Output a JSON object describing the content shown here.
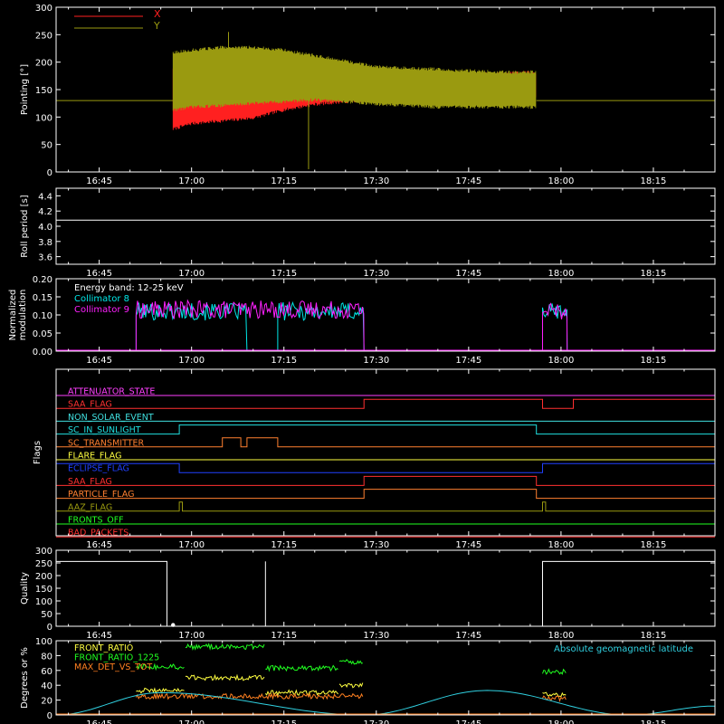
{
  "colors": {
    "background": "#000000",
    "frame": "#ffffff",
    "x_series": "#ff2020",
    "y_series": "#9a9a10",
    "collimator8": "#00e8e8",
    "collimator9": "#ff20ff",
    "front_ratio": "#ffff40",
    "front_ratio_1225": "#20ff20",
    "max_det": "#ff8020",
    "geomag": "#30d0e0"
  },
  "chart_data": [
    {
      "id": "pointing",
      "type": "line",
      "xlabel": "",
      "ylabel": "Pointing [°]",
      "x_ticks": [
        "16:45",
        "17:00",
        "17:15",
        "17:30",
        "17:45",
        "18:00",
        "18:15"
      ],
      "x_range": [
        "16:38",
        "18:25"
      ],
      "ylim": [
        0,
        300
      ],
      "y_ticks": [
        "0",
        "50",
        "100",
        "150",
        "200",
        "250",
        "300"
      ],
      "baseline": 130,
      "active_window": [
        "16:57",
        "17:56"
      ],
      "series": [
        {
          "name": "X",
          "color_key": "x_series",
          "x": [
            "16:57",
            "17:00",
            "17:05",
            "17:10",
            "17:15",
            "17:20",
            "17:25",
            "17:30",
            "17:40",
            "17:50",
            "17:56"
          ],
          "max": [
            190,
            185,
            185,
            185,
            185,
            183,
            182,
            180,
            180,
            182,
            185
          ],
          "min": [
            75,
            85,
            90,
            95,
            110,
            120,
            125,
            130,
            130,
            130,
            130
          ]
        },
        {
          "name": "Y",
          "color_key": "y_series",
          "x": [
            "16:57",
            "17:00",
            "17:05",
            "17:10",
            "17:15",
            "17:20",
            "17:25",
            "17:30",
            "17:40",
            "17:50",
            "17:56"
          ],
          "max": [
            220,
            225,
            230,
            230,
            225,
            215,
            205,
            195,
            190,
            185,
            185
          ],
          "min": [
            110,
            115,
            118,
            122,
            125,
            128,
            125,
            120,
            115,
            115,
            115
          ]
        }
      ],
      "spikes": [
        {
          "x": "17:06",
          "y": 255
        },
        {
          "x": "17:19",
          "y": 5
        }
      ]
    },
    {
      "id": "roll",
      "type": "line",
      "xlabel": "",
      "ylabel": "Roll period [s]",
      "x_ticks": [
        "16:45",
        "17:00",
        "17:15",
        "17:30",
        "17:45",
        "18:00",
        "18:15"
      ],
      "x_range": [
        "16:38",
        "18:25"
      ],
      "ylim": [
        3.5,
        4.5
      ],
      "y_ticks": [
        "3.6",
        "3.8",
        "4.0",
        "4.2",
        "4.4"
      ],
      "value": 4.08
    },
    {
      "id": "modulation",
      "type": "line",
      "xlabel": "",
      "ylabel": "Normalized modulation",
      "x_ticks": [
        "16:45",
        "17:00",
        "17:15",
        "17:30",
        "17:45",
        "18:00",
        "18:15"
      ],
      "x_range": [
        "16:38",
        "18:25"
      ],
      "ylim": [
        0,
        0.2
      ],
      "y_ticks": [
        "0.00",
        "0.05",
        "0.10",
        "0.15",
        "0.20"
      ],
      "annotation": "Energy band: 12-25 keV",
      "series": [
        {
          "name": "Collimator 8",
          "color_key": "collimator8",
          "segments": [
            {
              "x": [
                "16:51",
                "17:09"
              ],
              "mean": 0.11
            },
            {
              "x": [
                "17:14",
                "17:28"
              ],
              "mean": 0.11
            },
            {
              "x": [
                "17:57",
                "18:01"
              ],
              "mean": 0.11
            }
          ]
        },
        {
          "name": "Collimator 9",
          "color_key": "collimator9",
          "segments": [
            {
              "x": [
                "16:51",
                "17:28"
              ],
              "mean": 0.115
            },
            {
              "x": [
                "17:57",
                "18:01"
              ],
              "mean": 0.112
            }
          ]
        }
      ]
    },
    {
      "id": "flags",
      "type": "line",
      "xlabel": "",
      "ylabel": "Flags",
      "x_ticks": [
        "16:45",
        "17:00",
        "17:15",
        "17:30",
        "17:45",
        "18:00",
        "18:15"
      ],
      "x_range": [
        "16:38",
        "18:25"
      ],
      "series": [
        {
          "name": "ATTENUATOR_STATE",
          "color": "#ff40ff",
          "high_intervals": []
        },
        {
          "name": "SAA_FLAG",
          "color": "#ff3030",
          "high_intervals": [
            [
              "17:28",
              "17:57"
            ],
            [
              "18:02",
              "18:25"
            ]
          ]
        },
        {
          "name": "NON_SOLAR_EVENT",
          "color": "#40e0e0",
          "high_intervals": []
        },
        {
          "name": "SC_IN_SUNLIGHT",
          "color": "#20e0e0",
          "high_intervals": [
            [
              "16:58",
              "17:56"
            ]
          ]
        },
        {
          "name": "SC_TRANSMITTER",
          "color": "#ff8030",
          "high_intervals": [
            [
              "17:05",
              "17:08"
            ],
            [
              "17:09",
              "17:14"
            ]
          ]
        },
        {
          "name": "FLARE_FLAG",
          "color": "#ffff40",
          "high_intervals": []
        },
        {
          "name": "ECLIPSE_FLAG",
          "color": "#2040ff",
          "high_intervals": [
            [
              "16:38",
              "16:58"
            ],
            [
              "17:57",
              "18:25"
            ]
          ]
        },
        {
          "name": "SAA_FLAG",
          "color": "#ff3030",
          "high_intervals": [
            [
              "17:28",
              "17:56"
            ]
          ]
        },
        {
          "name": "PARTICLE_FLAG",
          "color": "#ff8030",
          "high_intervals": [
            [
              "17:28",
              "17:56"
            ]
          ]
        },
        {
          "name": "AAZ_FLAG",
          "color": "#9a9a10",
          "high_intervals": [
            [
              "16:58",
              "16:58.5"
            ],
            [
              "17:57",
              "17:57.5"
            ]
          ]
        },
        {
          "name": "FRONTS_OFF",
          "color": "#20ff20",
          "high_intervals": []
        },
        {
          "name": "BAD_PACKETS",
          "color": "#ff3030",
          "high_intervals": []
        }
      ]
    },
    {
      "id": "quality",
      "type": "line",
      "xlabel": "",
      "ylabel": "Quality",
      "x_ticks": [
        "16:45",
        "17:00",
        "17:15",
        "17:30",
        "17:45",
        "18:00",
        "18:15"
      ],
      "x_range": [
        "16:38",
        "18:25"
      ],
      "ylim": [
        0,
        300
      ],
      "y_ticks": [
        "0",
        "50",
        "100",
        "150",
        "200",
        "250",
        "300"
      ],
      "high_value": 256,
      "high_intervals": [
        [
          "16:38",
          "16:56"
        ],
        [
          "17:57",
          "18:25"
        ]
      ],
      "spikes": [
        {
          "x": "17:12",
          "y": 256
        }
      ],
      "dots": [
        {
          "x": "16:57",
          "y": 5
        }
      ]
    },
    {
      "id": "ratios",
      "type": "line",
      "xlabel": "",
      "ylabel": "Degrees or %",
      "x_ticks": [
        "16:45",
        "17:00",
        "17:15",
        "17:30",
        "17:45",
        "18:00",
        "18:15"
      ],
      "x_range": [
        "16:38",
        "18:25"
      ],
      "ylim": [
        0,
        100
      ],
      "y_ticks": [
        "0",
        "20",
        "40",
        "60",
        "80",
        "100"
      ],
      "right_label": "Absolute geomagnetic latitude",
      "series": [
        {
          "name": "FRONT_RATIO",
          "color_key": "front_ratio",
          "segments": [
            {
              "x": [
                "16:51",
                "16:59"
              ],
              "mean": 33
            },
            {
              "x": [
                "16:59",
                "17:12"
              ],
              "mean": 50
            },
            {
              "x": [
                "17:12",
                "17:24"
              ],
              "mean": 30
            },
            {
              "x": [
                "17:24",
                "17:28"
              ],
              "mean": 40
            },
            {
              "x": [
                "17:57",
                "18:01"
              ],
              "mean": 28
            }
          ]
        },
        {
          "name": "FRONT_RATIO_1225",
          "color_key": "front_ratio_1225",
          "segments": [
            {
              "x": [
                "16:51",
                "16:59"
              ],
              "mean": 65
            },
            {
              "x": [
                "16:59",
                "17:12"
              ],
              "mean": 92
            },
            {
              "x": [
                "17:12",
                "17:24"
              ],
              "mean": 63
            },
            {
              "x": [
                "17:24",
                "17:28"
              ],
              "mean": 72
            },
            {
              "x": [
                "17:57",
                "18:01"
              ],
              "mean": 58
            }
          ]
        },
        {
          "name": "MAX_DET_VS_TOT",
          "color_key": "max_det",
          "segments": [
            {
              "x": [
                "16:51",
                "17:28"
              ],
              "mean": 25
            },
            {
              "x": [
                "17:57",
                "18:01"
              ],
              "mean": 22
            }
          ]
        },
        {
          "name": "",
          "color_key": "geomag",
          "x": [
            "16:38",
            "16:55",
            "17:28",
            "17:48",
            "18:11",
            "18:25"
          ],
          "y": [
            0,
            30,
            0,
            33,
            0,
            12
          ]
        }
      ]
    }
  ]
}
